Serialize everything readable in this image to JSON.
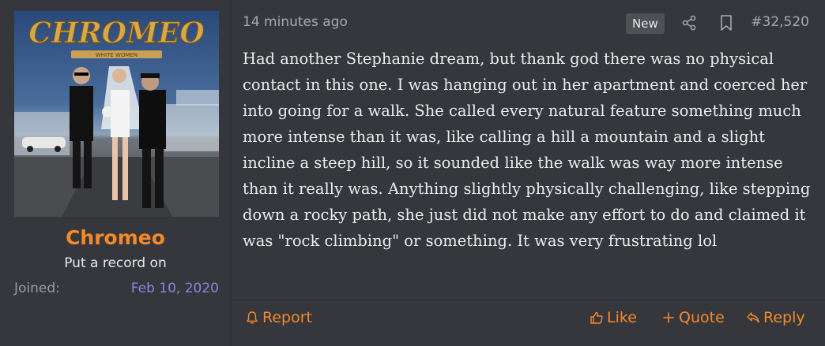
{
  "user": {
    "name": "Chromeo",
    "title": "Put a record on",
    "joined_label": "Joined:",
    "joined_date": "Feb 10, 2020",
    "avatar_art": {
      "band_logo": "CHROMEO",
      "album_text": "WHITE WOMEN"
    }
  },
  "post": {
    "time": "14 minutes ago",
    "badge": "New",
    "number": "#32,520",
    "message": "Had another Stephanie dream, but thank god there was no physical contact in this one. I was hanging out in her apartment and coerced her into going for a walk. She called every natural feature something much more intense than it was, like calling a hill a mountain and a slight incline a steep hill, so it sounded like the walk was way more intense than it really was. Anything slightly physically challenging, like stepping down a rocky path, she just did not make any effort to do and claimed it was \"rock climbing\" or something. It was very frustrating lol"
  },
  "actions": {
    "report": "Report",
    "like": "Like",
    "quote": "Quote",
    "reply": "Reply"
  },
  "colors": {
    "accent": "#f5892b",
    "date_link": "#8f82e0",
    "panel": "#35373c"
  },
  "icons": [
    "share-icon",
    "bookmark-icon",
    "bell-icon",
    "thumbs-up-icon",
    "plus-icon",
    "reply-icon"
  ]
}
